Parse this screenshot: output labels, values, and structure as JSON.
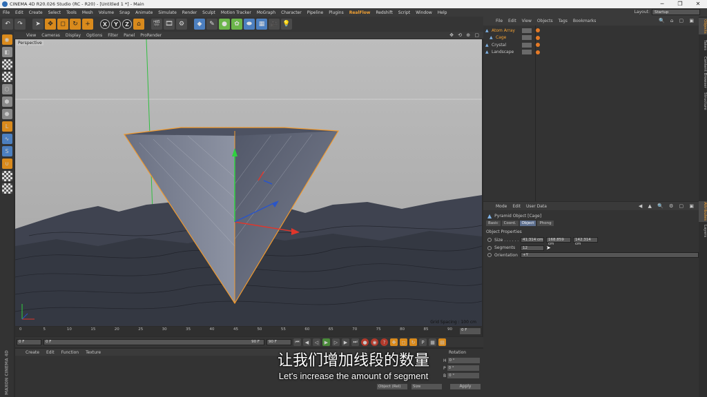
{
  "titlebar": {
    "title": "CINEMA 4D R20.026 Studio (RC - R20) - [Untitled 1 *] - Main",
    "minimize": "─",
    "maximize": "❐",
    "close": "✕"
  },
  "menubar": {
    "items": [
      "File",
      "Edit",
      "Create",
      "Select",
      "Tools",
      "Mesh",
      "Volume",
      "Snap",
      "Animate",
      "Simulate",
      "Render",
      "Sculpt",
      "Motion Tracker",
      "MoGraph",
      "Character",
      "Pipeline",
      "Plugins",
      "RealFlow",
      "Redshift",
      "Script",
      "Window",
      "Help"
    ],
    "highlighted": "RealFlow",
    "layout_label": "Layout:",
    "layout_value": "Startup"
  },
  "toolbar": {
    "x_label": "X",
    "y_label": "Y",
    "z_label": "Z"
  },
  "viewport": {
    "menu": [
      "View",
      "Cameras",
      "Display",
      "Options",
      "Filter",
      "Panel",
      "ProRender"
    ],
    "label": "Perspective",
    "grid_spacing": "Grid Spacing : 100 cm"
  },
  "timeline": {
    "ticks": [
      "0",
      "5",
      "10",
      "15",
      "20",
      "25",
      "30",
      "35",
      "40",
      "45",
      "50",
      "55",
      "60",
      "65",
      "70",
      "75",
      "80",
      "85",
      "90"
    ],
    "end_field": "0 F"
  },
  "playbar": {
    "start": "0 F",
    "current": "0 F",
    "range_end": "90 F",
    "end": "90 F"
  },
  "material_panel": {
    "menu": [
      "Create",
      "Edit",
      "Function",
      "Texture"
    ]
  },
  "logo": {
    "text": "MAXON CINEMA 4D"
  },
  "coords": {
    "title": "Rotation",
    "h": "0 °",
    "p": "0 °",
    "b": "0 °",
    "h_label": "H",
    "p_label": "P",
    "b_label": "B",
    "mode": "Object (Rel)",
    "size_mode": "Size",
    "apply": "Apply"
  },
  "subtitles": {
    "cn": "让我们增加线段的数量",
    "en": "Let's increase the amount of segment"
  },
  "object_manager": {
    "menu": [
      "File",
      "Edit",
      "View",
      "Objects",
      "Tags",
      "Bookmarks"
    ],
    "objects": [
      {
        "name": "Atom Array",
        "selected": true
      },
      {
        "name": "Cage",
        "selected": true
      },
      {
        "name": "Crystal",
        "selected": false
      },
      {
        "name": "Landscape",
        "selected": false
      }
    ]
  },
  "side_tabs": [
    "Objects",
    "Takes",
    "Content Browser",
    "Structure",
    "Attributes",
    "Layers"
  ],
  "attributes": {
    "menu": [
      "Mode",
      "Edit",
      "User Data"
    ],
    "title": "Pyramid Object [Cage]",
    "tabs": [
      "Basic",
      "Coord.",
      "Object",
      "Phong"
    ],
    "active_tab": "Object",
    "section": "Object Properties",
    "size_label": "Size . . . . . .",
    "size_values": [
      "41.314 cm",
      "168.859 cm",
      "142.314 cm"
    ],
    "segments_label": "Segments",
    "segments_value": "12",
    "orientation_label": "Orientation",
    "orientation_value": "+Y"
  }
}
